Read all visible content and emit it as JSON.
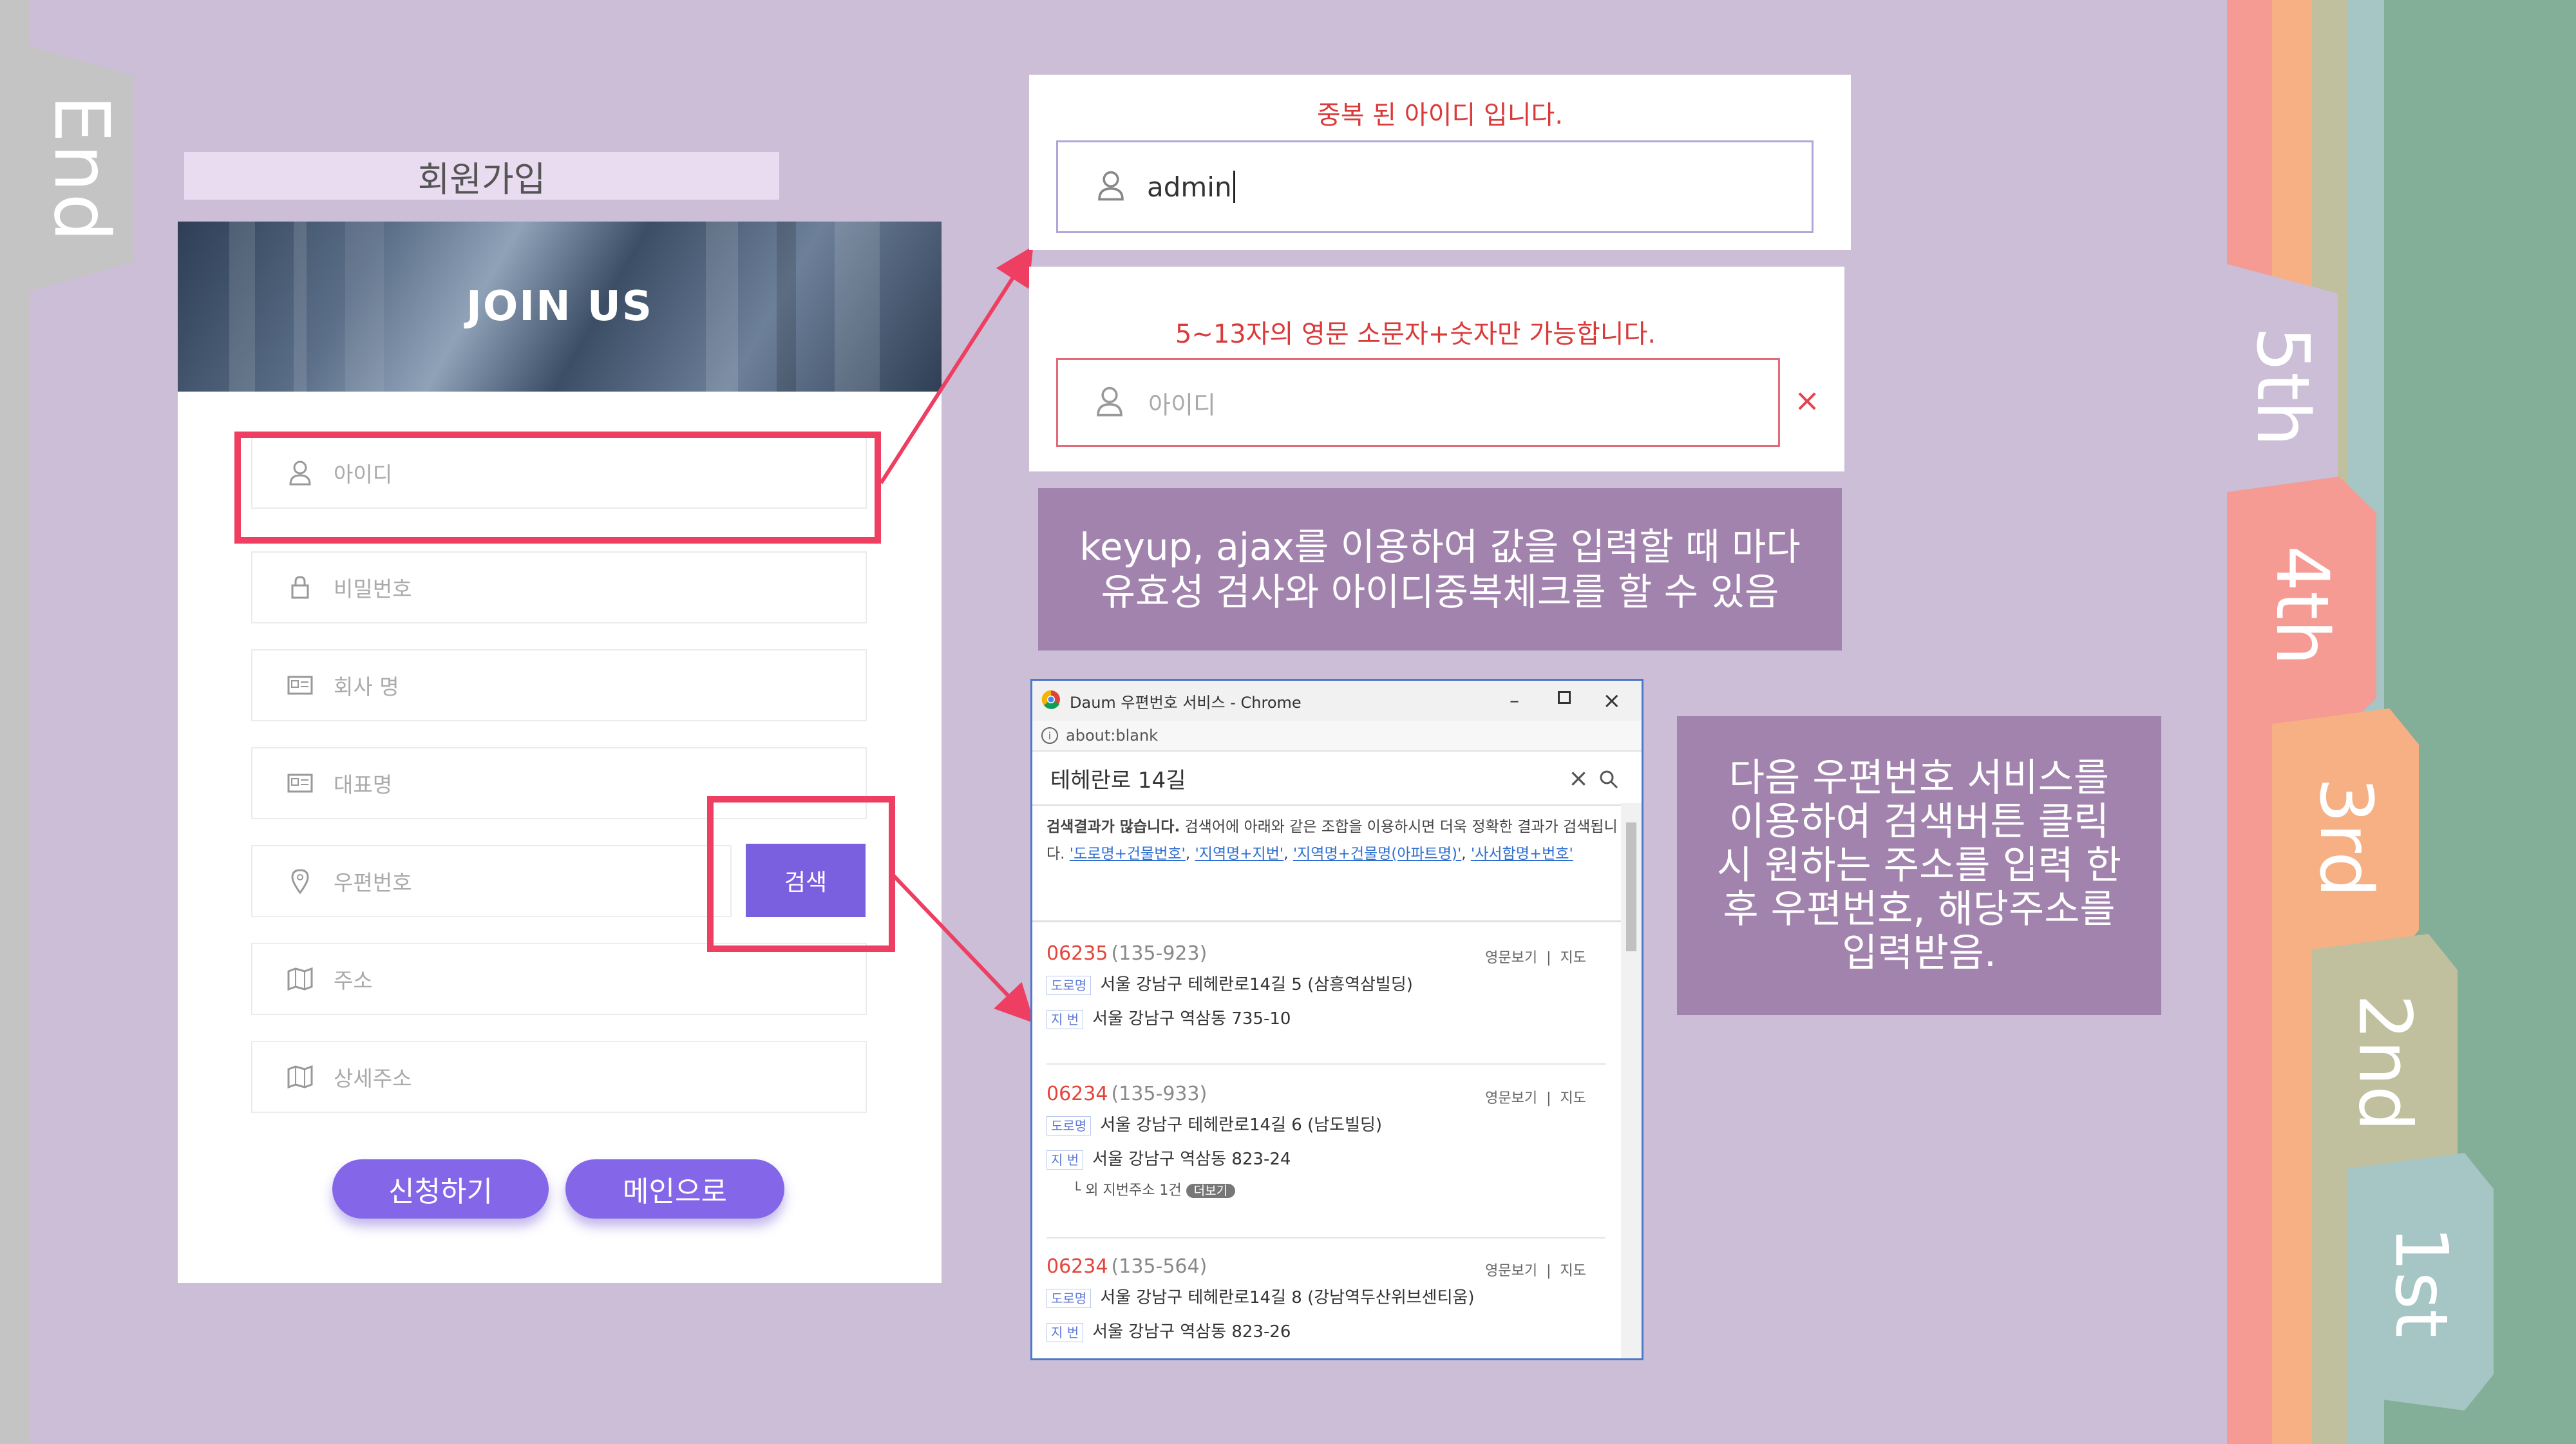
{
  "slide": {
    "end_tab": "End",
    "right_tabs": [
      "5th",
      "4th",
      "3rd",
      "2nd",
      "1st"
    ],
    "colors": {
      "background": "#cbbed6",
      "accent_red": "#ee3e61",
      "button_purple": "#8466e8",
      "description_box": "#a183ad"
    }
  },
  "signup": {
    "heading": "회원가입",
    "banner_title": "JOIN US",
    "fields": [
      {
        "icon": "user-icon",
        "placeholder": "아이디"
      },
      {
        "icon": "lock-icon",
        "placeholder": "비밀번호"
      },
      {
        "icon": "id-card-icon",
        "placeholder": "회사 명"
      },
      {
        "icon": "id-card-icon",
        "placeholder": "대표명"
      },
      {
        "icon": "map-pin-icon",
        "placeholder": "우편번호"
      },
      {
        "icon": "map-icon",
        "placeholder": "주소"
      },
      {
        "icon": "map-icon",
        "placeholder": "상세주소"
      }
    ],
    "search_button": "검색",
    "submit_button": "신청하기",
    "main_button": "메인으로"
  },
  "id_duplicate": {
    "message": "중복 된 아이디 입니다.",
    "value": "admin"
  },
  "id_invalid": {
    "message": "5~13자의 영문 소문자+숫자만 가능합니다.",
    "placeholder": "아이디",
    "clear_icon": "×"
  },
  "desc_ajax": {
    "lines": [
      "keyup, ajax를 이용하여 값을 입력할 때 마다",
      "유효성 검사와 아이디중복체크를 할 수 있음"
    ]
  },
  "desc_post": {
    "lines": [
      "다음 우편번호 서비스를",
      "이용하여 검색버튼 클릭",
      "시 원하는 주소를 입력 한",
      "후 우편번호, 해당주소를",
      "입력받음."
    ]
  },
  "postcode_window": {
    "title": "Daum 우편번호 서비스 - Chrome",
    "url": "about:blank",
    "query": "테헤란로 14길",
    "notice_bold": "검색결과가 많습니다.",
    "notice_text": " 검색어에 아래와 같은 조합을 이용하시면 더욱 정확한 결과가 검색됩니다.",
    "notice_links": [
      "'도로명+건물번호'",
      "'지역명+지번'",
      "'지역명+건물명(아파트명)'",
      "'사서함명+번호'"
    ],
    "road_tag": "도로명",
    "lot_tag": "지 번",
    "view_english": "영문보기",
    "map_link": "지도",
    "results": [
      {
        "zip": "06235",
        "old_zip": "(135-923)",
        "road": "서울 강남구 테헤란로14길 5 (삼흥역삼빌딩)",
        "lot": "서울 강남구 역삼동 735-10",
        "extra": "",
        "more": ""
      },
      {
        "zip": "06234",
        "old_zip": "(135-933)",
        "road": "서울 강남구 테헤란로14길 6 (남도빌딩)",
        "lot": "서울 강남구 역삼동 823-24",
        "extra": "└ 외 지번주소 1건",
        "more": "더보기"
      },
      {
        "zip": "06234",
        "old_zip": "(135-564)",
        "road": "서울 강남구 테헤란로14길 8 (강남역두산위브센티움)",
        "lot": "서울 강남구 역삼동 823-26",
        "extra": "",
        "more": ""
      }
    ]
  }
}
